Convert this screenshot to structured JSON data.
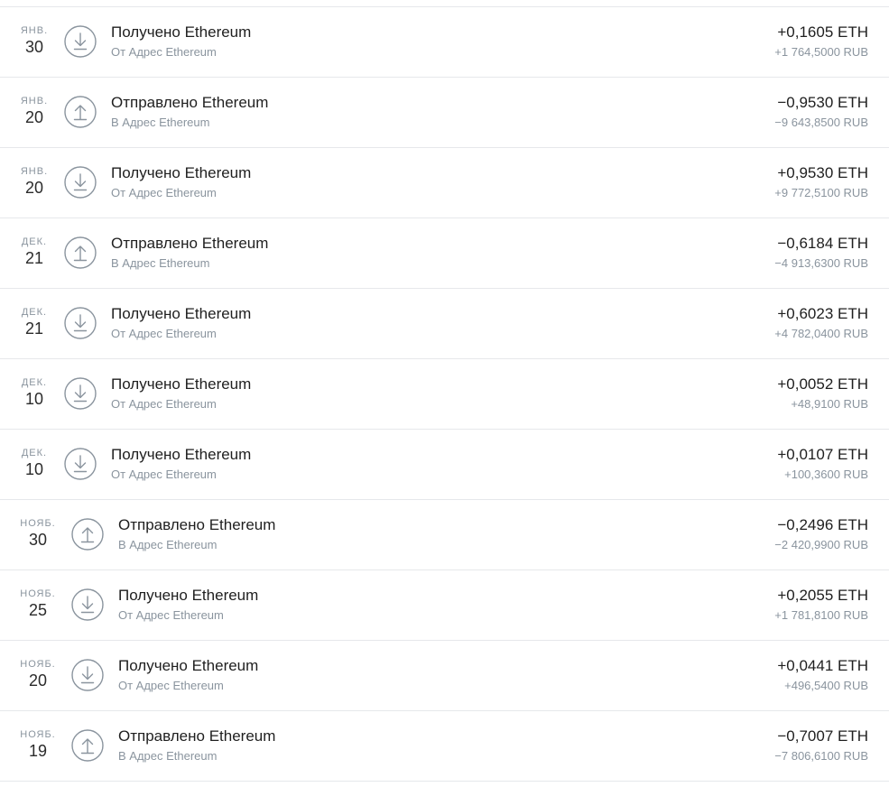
{
  "transactions": [
    {
      "month": "ЯНВ.",
      "day": "30",
      "type": "received",
      "icon": "arrow-down-icon",
      "title": "Получено Ethereum",
      "subtitle": "От Адрес Ethereum",
      "amount": "+0,1605 ETH",
      "fiat": "+1 764,5000 RUB"
    },
    {
      "month": "ЯНВ.",
      "day": "20",
      "type": "sent",
      "icon": "arrow-up-icon",
      "title": "Отправлено Ethereum",
      "subtitle": "В Адрес Ethereum",
      "amount": "−0,9530 ETH",
      "fiat": "−9 643,8500 RUB"
    },
    {
      "month": "ЯНВ.",
      "day": "20",
      "type": "received",
      "icon": "arrow-down-icon",
      "title": "Получено Ethereum",
      "subtitle": "От Адрес Ethereum",
      "amount": "+0,9530 ETH",
      "fiat": "+9 772,5100 RUB"
    },
    {
      "month": "ДЕК.",
      "day": "21",
      "type": "sent",
      "icon": "arrow-up-icon",
      "title": "Отправлено Ethereum",
      "subtitle": "В Адрес Ethereum",
      "amount": "−0,6184 ETH",
      "fiat": "−4 913,6300 RUB"
    },
    {
      "month": "ДЕК.",
      "day": "21",
      "type": "received",
      "icon": "arrow-down-icon",
      "title": "Получено Ethereum",
      "subtitle": "От Адрес Ethereum",
      "amount": "+0,6023 ETH",
      "fiat": "+4 782,0400 RUB"
    },
    {
      "month": "ДЕК.",
      "day": "10",
      "type": "received",
      "icon": "arrow-down-icon",
      "title": "Получено Ethereum",
      "subtitle": "От Адрес Ethereum",
      "amount": "+0,0052 ETH",
      "fiat": "+48,9100 RUB"
    },
    {
      "month": "ДЕК.",
      "day": "10",
      "type": "received",
      "icon": "arrow-down-icon",
      "title": "Получено Ethereum",
      "subtitle": "От Адрес Ethereum",
      "amount": "+0,0107 ETH",
      "fiat": "+100,3600 RUB"
    },
    {
      "month": "НОЯБ.",
      "day": "30",
      "type": "sent",
      "icon": "arrow-up-icon",
      "title": "Отправлено Ethereum",
      "subtitle": "В Адрес Ethereum",
      "amount": "−0,2496 ETH",
      "fiat": "−2 420,9900 RUB"
    },
    {
      "month": "НОЯБ.",
      "day": "25",
      "type": "received",
      "icon": "arrow-down-icon",
      "title": "Получено Ethereum",
      "subtitle": "От Адрес Ethereum",
      "amount": "+0,2055 ETH",
      "fiat": "+1 781,8100 RUB"
    },
    {
      "month": "НОЯБ.",
      "day": "20",
      "type": "received",
      "icon": "arrow-down-icon",
      "title": "Получено Ethereum",
      "subtitle": "От Адрес Ethereum",
      "amount": "+0,0441 ETH",
      "fiat": "+496,5400 RUB"
    },
    {
      "month": "НОЯБ.",
      "day": "19",
      "type": "sent",
      "icon": "arrow-up-icon",
      "title": "Отправлено Ethereum",
      "subtitle": "В Адрес Ethereum",
      "amount": "−0,7007 ETH",
      "fiat": "−7 806,6100 RUB"
    }
  ],
  "colors": {
    "icon_stroke": "#8a949e",
    "divider": "#e6e8eb",
    "muted_text": "#8a949e",
    "primary_text": "#1f1f1f"
  }
}
